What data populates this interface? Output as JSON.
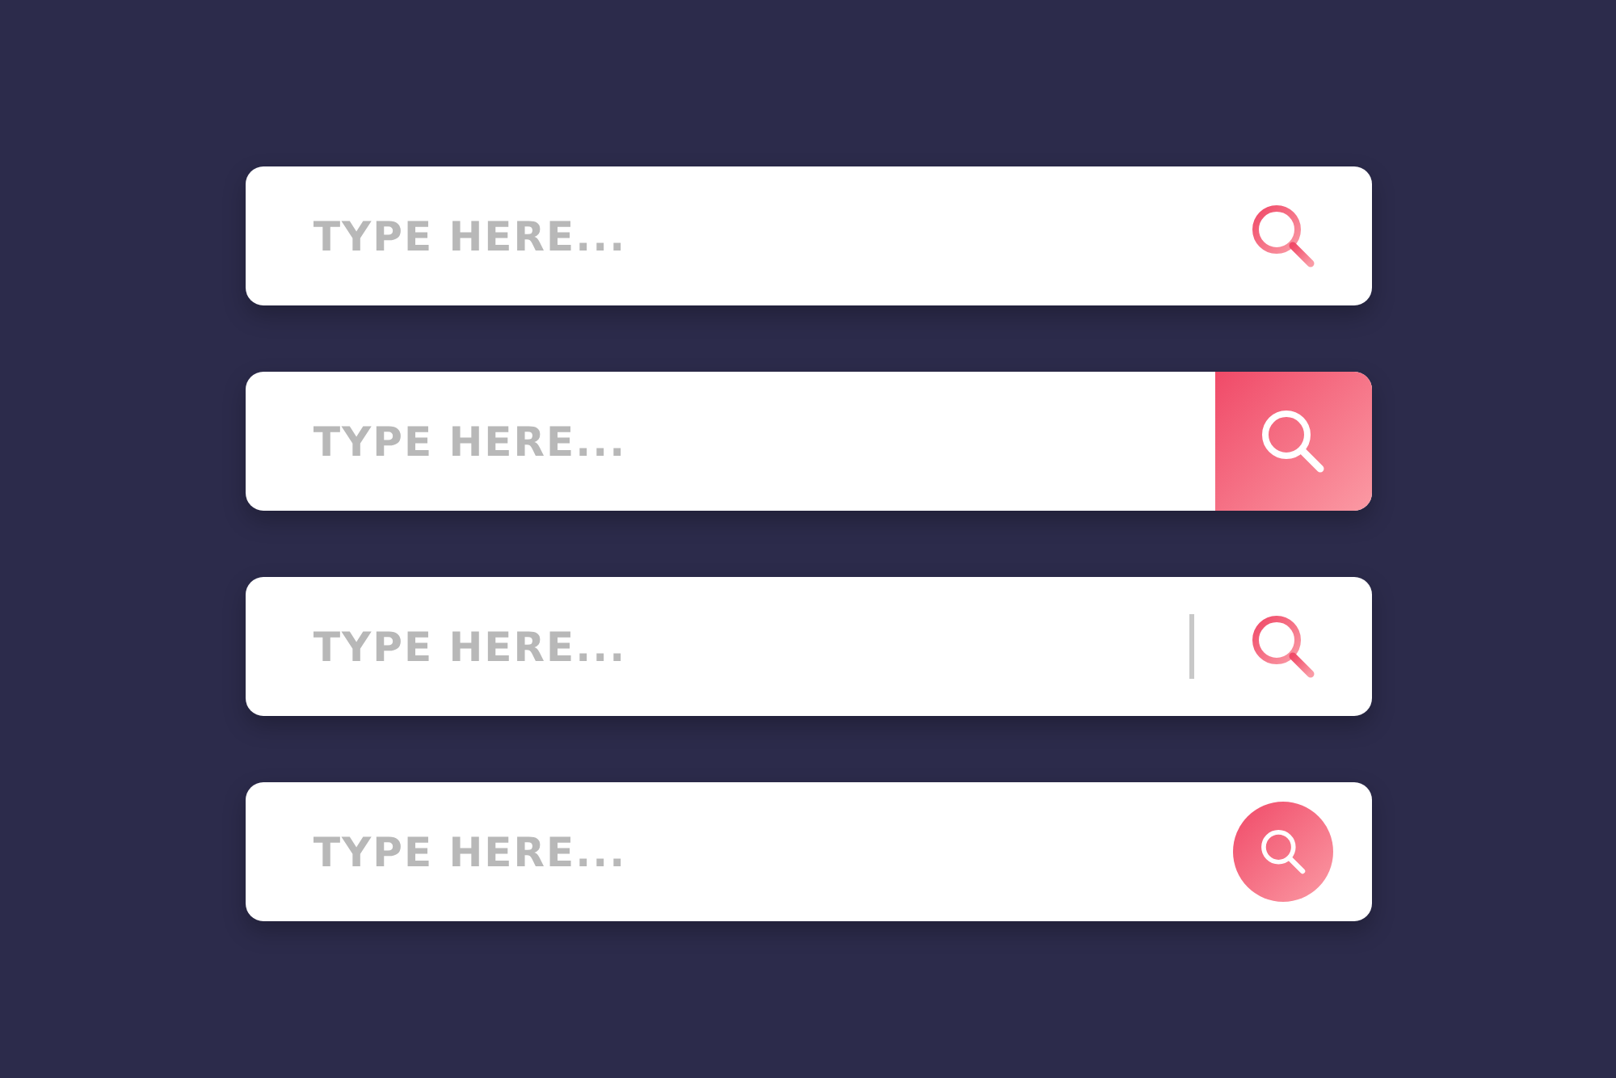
{
  "search_bars": [
    {
      "kind": "icon",
      "placeholder": "TYPE HERE..."
    },
    {
      "kind": "filled",
      "placeholder": "TYPE HERE..."
    },
    {
      "kind": "divider",
      "placeholder": "TYPE HERE..."
    },
    {
      "kind": "circle",
      "placeholder": "TYPE HERE..."
    }
  ]
}
